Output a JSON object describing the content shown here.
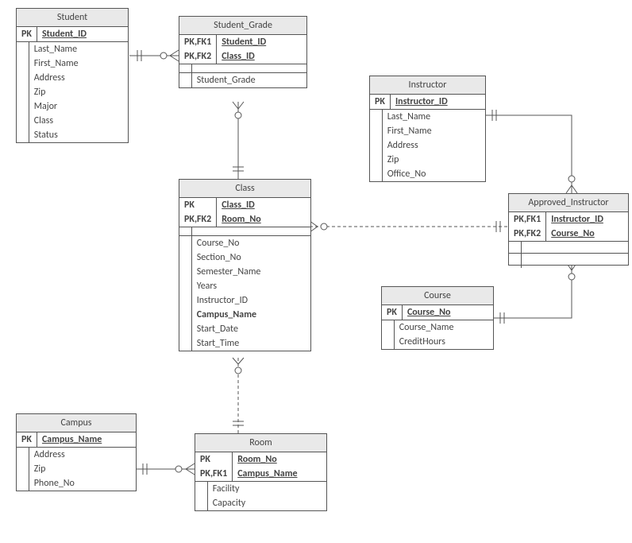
{
  "entities": {
    "student": {
      "title": "Student",
      "pk": [
        [
          "PK",
          "Student_ID"
        ]
      ],
      "attrs": [
        "Last_Name",
        "First_Name",
        "Address",
        "Zip",
        "Major",
        "Class",
        "Status"
      ]
    },
    "student_grade": {
      "title": "Student_Grade",
      "pk": [
        [
          "PK,FK1",
          "Student_ID"
        ],
        [
          "PK,FK2",
          "Class_ID"
        ]
      ],
      "attrs": [
        "Student_Grade"
      ]
    },
    "class": {
      "title": "Class",
      "pk": [
        [
          "PK",
          "Class_ID"
        ],
        [
          "PK,FK2",
          "Room_No"
        ]
      ],
      "attrs": [
        "Course_No",
        "Section_No",
        "Semester_Name",
        "Years",
        "Instructor_ID",
        "Campus_Name",
        "Start_Date",
        "Start_Time"
      ],
      "bold_attrs": [
        "Campus_Name"
      ]
    },
    "instructor": {
      "title": "Instructor",
      "pk": [
        [
          "PK",
          "Instructor_ID"
        ]
      ],
      "attrs": [
        "Last_Name",
        "First_Name",
        "Address",
        "Zip",
        "Office_No"
      ]
    },
    "approved_instructor": {
      "title": "Approved_Instructor",
      "pk": [
        [
          "PK,FK1",
          "Instructor_ID"
        ],
        [
          "PK,FK2",
          "Course_No"
        ]
      ],
      "attrs": [
        ""
      ]
    },
    "course": {
      "title": "Course",
      "pk": [
        [
          "PK",
          "Course_No"
        ]
      ],
      "attrs": [
        "Course_Name",
        "CreditHours"
      ]
    },
    "campus": {
      "title": "Campus",
      "pk": [
        [
          "PK",
          "Campus_Name"
        ]
      ],
      "attrs": [
        "Address",
        "Zip",
        "Phone_No"
      ]
    },
    "room": {
      "title": "Room",
      "pk": [
        [
          "PK",
          "Room_No"
        ],
        [
          "PK,FK1",
          "Campus_Name"
        ]
      ],
      "attrs": [
        "Facility",
        "Capacity"
      ]
    }
  }
}
